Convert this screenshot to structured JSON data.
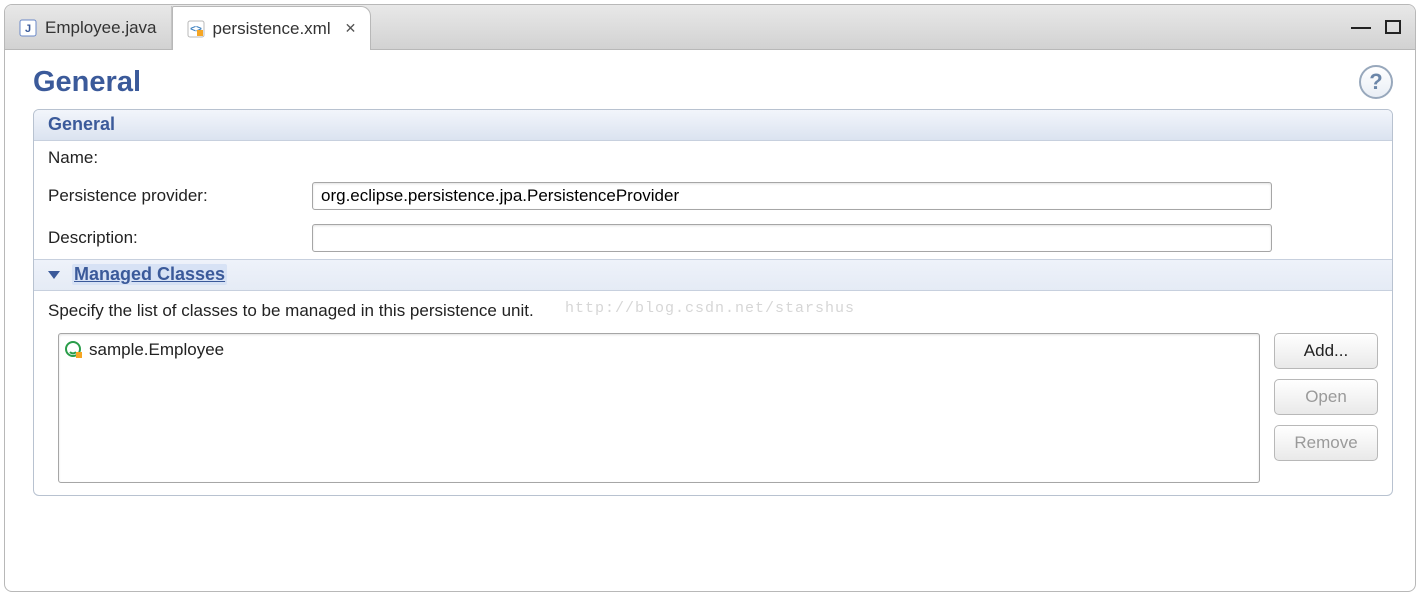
{
  "tabs": [
    {
      "label": "Employee.java",
      "active": false
    },
    {
      "label": "persistence.xml",
      "active": true
    }
  ],
  "header": {
    "title": "General"
  },
  "section_general": {
    "title": "General",
    "name_label": "Name:",
    "name_value": "",
    "provider_label": "Persistence provider:",
    "provider_value": "org.eclipse.persistence.jpa.PersistenceProvider",
    "description_label": "Description:",
    "description_value": ""
  },
  "section_managed": {
    "title": "Managed Classes",
    "hint": "Specify the list of classes to be managed in this persistence unit.",
    "items": [
      {
        "label": "sample.Employee"
      }
    ],
    "buttons": {
      "add": "Add...",
      "open": "Open",
      "remove": "Remove"
    }
  },
  "watermark": "http://blog.csdn.net/starshus"
}
